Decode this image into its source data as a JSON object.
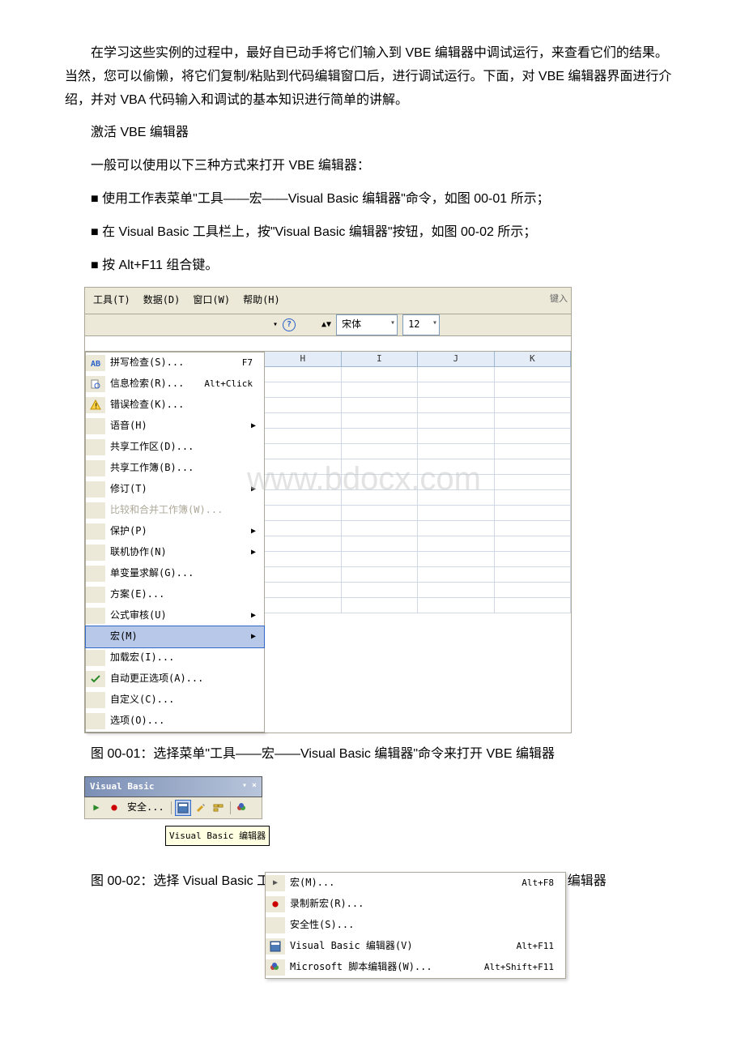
{
  "paragraphs": {
    "p1": "在学习这些实例的过程中，最好自已动手将它们输入到 VBE 编辑器中调试运行，来查看它们的结果。当然，您可以偷懒，将它们复制/粘贴到代码编辑窗口后，进行调试运行。下面，对 VBE 编辑器界面进行介绍，并对 VBA 代码输入和调试的基本知识进行简单的讲解。",
    "p2": "激活 VBE 编辑器",
    "p3": "一般可以使用以下三种方式来打开 VBE 编辑器：",
    "b1": "■ 使用工作表菜单\"工具——宏——Visual Basic 编辑器\"命令，如图 00-01 所示；",
    "b2": "■ 在 Visual Basic 工具栏上，按\"Visual Basic 编辑器\"按钮，如图 00-02 所示；",
    "b3": "■ 按 Alt+F11 组合键。",
    "caption1": "图 00-01：选择菜单\"工具——宏——Visual Basic 编辑器\"命令来打开 VBE 编辑器",
    "caption2": "图 00-02：选择 Visual Basic 工具栏上的\"Visual Basic 编辑器\"命令按钮来打开 VBE 编辑器"
  },
  "menubar": {
    "tools": "工具(T)",
    "data": "数据(D)",
    "window": "窗口(W)",
    "help": "帮助(H)",
    "keyin": "键入"
  },
  "toolbar": {
    "font": "宋体",
    "size": "12"
  },
  "columns": [
    "H",
    "I",
    "J",
    "K"
  ],
  "toolsMenu": [
    {
      "label": "拼写检查(S)...",
      "shortcut": "F7",
      "icon": "spell"
    },
    {
      "label": "信息检索(R)...",
      "shortcut": "Alt+Click",
      "icon": "research"
    },
    {
      "label": "错误检查(K)...",
      "icon": "error"
    },
    {
      "label": "语音(H)",
      "arrow": true
    },
    {
      "label": "共享工作区(D)..."
    },
    {
      "label": "共享工作簿(B)..."
    },
    {
      "label": "修订(T)",
      "arrow": true
    },
    {
      "label": "比较和合并工作簿(W)...",
      "disabled": true
    },
    {
      "label": "保护(P)",
      "arrow": true
    },
    {
      "label": "联机协作(N)",
      "arrow": true
    },
    {
      "label": "单变量求解(G)..."
    },
    {
      "label": "方案(E)..."
    },
    {
      "label": "公式审核(U)",
      "arrow": true
    },
    {
      "label": "宏(M)",
      "arrow": true,
      "highlighted": true
    },
    {
      "label": "加载宏(I)..."
    },
    {
      "label": "自动更正选项(A)...",
      "icon": "autocorrect"
    },
    {
      "label": "自定义(C)..."
    },
    {
      "label": "选项(O)..."
    }
  ],
  "macroSubmenu": [
    {
      "label": "宏(M)...",
      "shortcut": "Alt+F8",
      "arrow_left": true
    },
    {
      "label": "录制新宏(R)...",
      "icon": "record"
    },
    {
      "label": "安全性(S)..."
    },
    {
      "label": "Visual Basic 编辑器(V)",
      "shortcut": "Alt+F11",
      "icon": "vbe"
    },
    {
      "label": "Microsoft 脚本编辑器(W)...",
      "shortcut": "Alt+Shift+F11",
      "icon": "script"
    }
  ],
  "vbToolbar": {
    "title": "Visual Basic",
    "security": "安全...",
    "tooltip": "Visual Basic 编辑器"
  },
  "watermark": "www.bdocx.com"
}
